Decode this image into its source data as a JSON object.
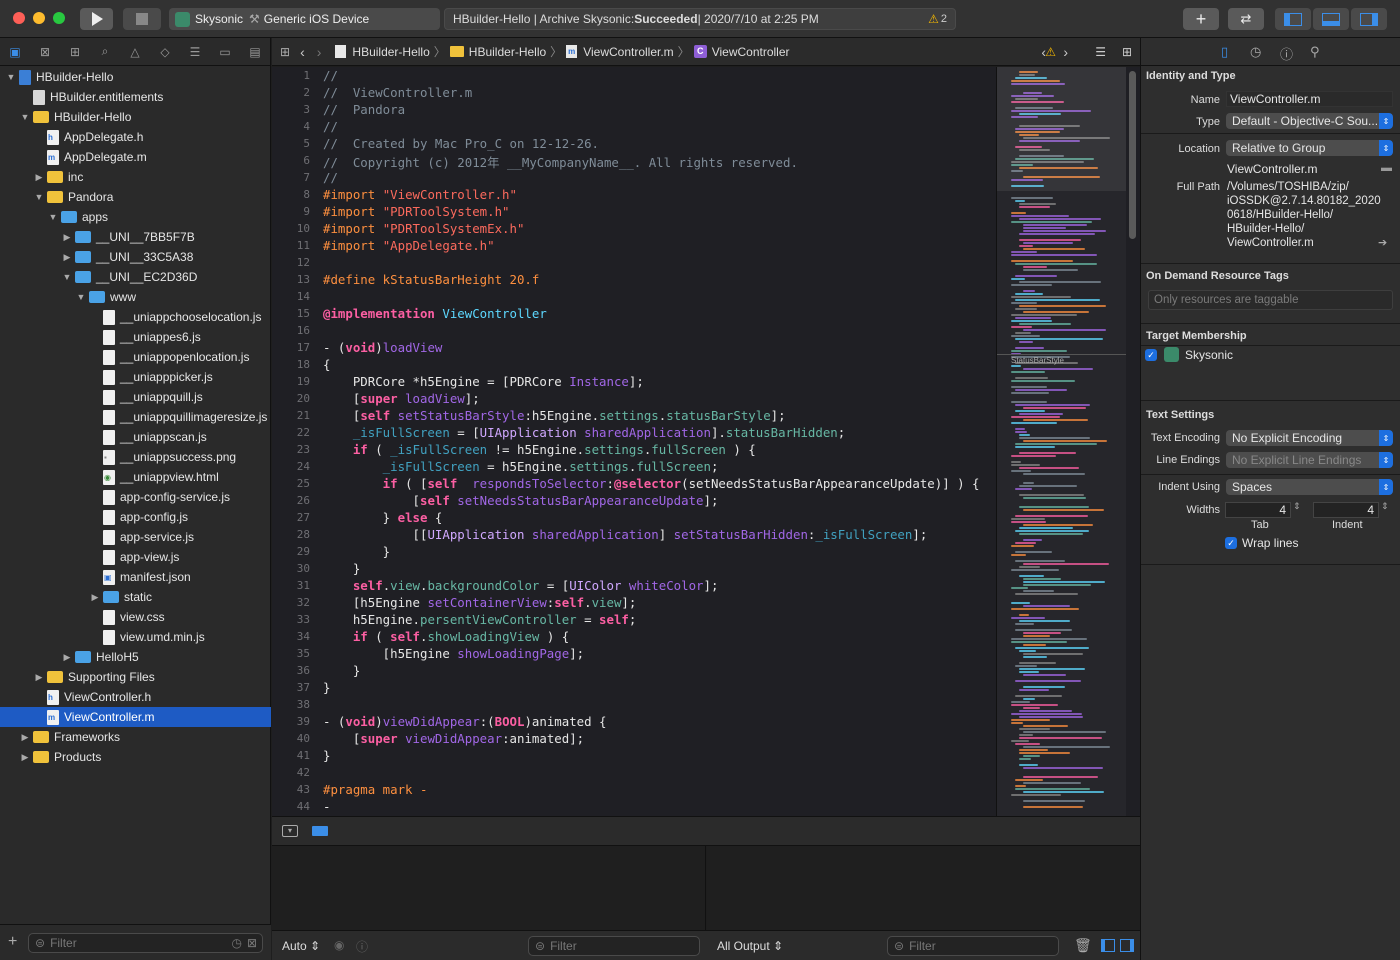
{
  "toolbar": {
    "scheme": "Skysonic",
    "device": "Generic iOS Device",
    "status_prefix": "HBuilder-Hello | Archive Skysonic: ",
    "status_result": "Succeeded",
    "status_time": " | 2020/7/10 at 2:25 PM",
    "warning_count": "2",
    "add_label": "+",
    "swap_label": "⇄"
  },
  "navigator": {
    "filter_placeholder": "Filter",
    "add_label": "+",
    "rows": [
      {
        "label": "HBuilder-Hello",
        "disc": "▼",
        "icon": "project",
        "indent": 0
      },
      {
        "label": "HBuilder.entitlements",
        "disc": "",
        "icon": "entitlements",
        "indent": 1
      },
      {
        "label": "HBuilder-Hello",
        "disc": "▼",
        "icon": "folder",
        "indent": 1
      },
      {
        "label": "AppDelegate.h",
        "disc": "",
        "icon": "h",
        "indent": 2
      },
      {
        "label": "AppDelegate.m",
        "disc": "",
        "icon": "m",
        "indent": 2
      },
      {
        "label": "inc",
        "disc": "▶",
        "icon": "folder",
        "indent": 2
      },
      {
        "label": "Pandora",
        "disc": "▼",
        "icon": "folder",
        "indent": 2
      },
      {
        "label": "apps",
        "disc": "▼",
        "icon": "bfolder",
        "indent": 3
      },
      {
        "label": "__UNI__7BB5F7B",
        "disc": "▶",
        "icon": "bfolder",
        "indent": 4
      },
      {
        "label": "__UNI__33C5A38",
        "disc": "▶",
        "icon": "bfolder",
        "indent": 4
      },
      {
        "label": "__UNI__EC2D36D",
        "disc": "▼",
        "icon": "bfolder",
        "indent": 4
      },
      {
        "label": "www",
        "disc": "▼",
        "icon": "bfolder",
        "indent": 5
      },
      {
        "label": "__uniappchooselocation.js",
        "disc": "",
        "icon": "doc",
        "indent": 6
      },
      {
        "label": "__uniappes6.js",
        "disc": "",
        "icon": "doc",
        "indent": 6
      },
      {
        "label": "__uniappopenlocation.js",
        "disc": "",
        "icon": "doc",
        "indent": 6
      },
      {
        "label": "__uniapppicker.js",
        "disc": "",
        "icon": "doc",
        "indent": 6
      },
      {
        "label": "__uniappquill.js",
        "disc": "",
        "icon": "doc",
        "indent": 6
      },
      {
        "label": "__uniappquillimageresize.js",
        "disc": "",
        "icon": "doc",
        "indent": 6
      },
      {
        "label": "__uniappscan.js",
        "disc": "",
        "icon": "doc",
        "indent": 6
      },
      {
        "label": "__uniappsuccess.png",
        "disc": "",
        "icon": "img",
        "indent": 6
      },
      {
        "label": "__uniappview.html",
        "disc": "",
        "icon": "html",
        "indent": 6
      },
      {
        "label": "app-config-service.js",
        "disc": "",
        "icon": "doc",
        "indent": 6
      },
      {
        "label": "app-config.js",
        "disc": "",
        "icon": "doc",
        "indent": 6
      },
      {
        "label": "app-service.js",
        "disc": "",
        "icon": "doc",
        "indent": 6
      },
      {
        "label": "app-view.js",
        "disc": "",
        "icon": "doc",
        "indent": 6
      },
      {
        "label": "manifest.json",
        "disc": "",
        "icon": "json",
        "indent": 6
      },
      {
        "label": "static",
        "disc": "▶",
        "icon": "bfolder",
        "indent": 6
      },
      {
        "label": "view.css",
        "disc": "",
        "icon": "doc",
        "indent": 6
      },
      {
        "label": "view.umd.min.js",
        "disc": "",
        "icon": "doc",
        "indent": 6
      },
      {
        "label": "HelloH5",
        "disc": "▶",
        "icon": "bfolder",
        "indent": 4
      },
      {
        "label": "Supporting Files",
        "disc": "▶",
        "icon": "folder",
        "indent": 2
      },
      {
        "label": "ViewController.h",
        "disc": "",
        "icon": "h",
        "indent": 2
      },
      {
        "label": "ViewController.m",
        "disc": "",
        "icon": "m",
        "indent": 2,
        "selected": true
      },
      {
        "label": "Frameworks",
        "disc": "▶",
        "icon": "folder",
        "indent": 1
      },
      {
        "label": "Products",
        "disc": "▶",
        "icon": "folder",
        "indent": 1
      }
    ]
  },
  "jumpbar": {
    "crumbs": [
      "HBuilder-Hello",
      "HBuilder-Hello",
      "ViewController.m",
      "ViewController"
    ]
  },
  "code_lines": [
    [
      [
        "c-cm",
        "//"
      ]
    ],
    [
      [
        "c-cm",
        "//  ViewController.m"
      ]
    ],
    [
      [
        "c-cm",
        "//  Pandora"
      ]
    ],
    [
      [
        "c-cm",
        "//"
      ]
    ],
    [
      [
        "c-cm",
        "//  Created by Mac Pro_C on 12-12-26."
      ]
    ],
    [
      [
        "c-cm",
        "//  Copyright (c) 2012年 __MyCompanyName__. All rights reserved."
      ]
    ],
    [
      [
        "c-cm",
        "//"
      ]
    ],
    [
      [
        "c-pp",
        "#import "
      ],
      [
        "c-st",
        "\"ViewController.h\""
      ]
    ],
    [
      [
        "c-pp",
        "#import "
      ],
      [
        "c-st",
        "\"PDRToolSystem.h\""
      ]
    ],
    [
      [
        "c-pp",
        "#import "
      ],
      [
        "c-st",
        "\"PDRToolSystemEx.h\""
      ]
    ],
    [
      [
        "c-pp",
        "#import "
      ],
      [
        "c-st",
        "\"AppDelegate.h\""
      ]
    ],
    [],
    [
      [
        "c-pp",
        "#define kStatusBarHeight 20.f"
      ]
    ],
    [],
    [
      [
        "c-kw",
        "@implementation "
      ],
      [
        "c-ty",
        "ViewController"
      ]
    ],
    [],
    [
      [
        "",
        "- ("
      ],
      [
        "c-kw",
        "void"
      ],
      [
        "",
        ")"
      ],
      [
        "c-mt",
        "loadView"
      ]
    ],
    [
      [
        "",
        "{"
      ]
    ],
    [
      [
        "",
        "    PDRCore *h5Engine = [PDRCore "
      ],
      [
        "c-mt",
        "Instance"
      ],
      [
        "",
        "];"
      ]
    ],
    [
      [
        "",
        "    ["
      ],
      [
        "c-kw",
        "super "
      ],
      [
        "c-mt",
        "loadView"
      ],
      [
        "",
        "];"
      ]
    ],
    [
      [
        "",
        "    ["
      ],
      [
        "c-kw",
        "self "
      ],
      [
        "c-mt",
        "setStatusBarStyle"
      ],
      [
        "",
        ":h5Engine."
      ],
      [
        "c-pr",
        "settings"
      ],
      [
        "",
        "."
      ],
      [
        "c-pr",
        "statusBarStyle"
      ],
      [
        "",
        "];"
      ]
    ],
    [
      [
        "c-id",
        "    _isFullScreen"
      ],
      [
        "",
        " = ["
      ],
      [
        "c-cls",
        "UIApplication "
      ],
      [
        "c-mt",
        "sharedApplication"
      ],
      [
        "",
        "]."
      ],
      [
        "c-pr",
        "statusBarHidden"
      ],
      [
        "",
        ";"
      ]
    ],
    [
      [
        "c-kw",
        "    if"
      ],
      [
        "",
        " ( "
      ],
      [
        "c-id",
        "_isFullScreen"
      ],
      [
        "",
        " != h5Engine."
      ],
      [
        "c-pr",
        "settings"
      ],
      [
        "",
        "."
      ],
      [
        "c-pr",
        "fullScreen"
      ],
      [
        "",
        " ) {"
      ]
    ],
    [
      [
        "c-id",
        "        _isFullScreen"
      ],
      [
        "",
        " = h5Engine."
      ],
      [
        "c-pr",
        "settings"
      ],
      [
        "",
        "."
      ],
      [
        "c-pr",
        "fullScreen"
      ],
      [
        "",
        ";"
      ]
    ],
    [
      [
        "c-kw",
        "        if"
      ],
      [
        "",
        " ( ["
      ],
      [
        "c-kw",
        "self"
      ],
      [
        "",
        "  "
      ],
      [
        "c-mt",
        "respondsToSelector"
      ],
      [
        "",
        ":"
      ],
      [
        "c-kw",
        "@selector"
      ],
      [
        "",
        "(setNeedsStatusBarAppearanceUpdate)] ) {"
      ]
    ],
    [
      [
        "",
        "            ["
      ],
      [
        "c-kw",
        "self "
      ],
      [
        "c-mt",
        "setNeedsStatusBarAppearanceUpdate"
      ],
      [
        "",
        "];"
      ]
    ],
    [
      [
        "",
        "        } "
      ],
      [
        "c-kw",
        "else"
      ],
      [
        "",
        " {"
      ]
    ],
    [
      [
        "",
        "            [["
      ],
      [
        "c-cls",
        "UIApplication "
      ],
      [
        "c-mt",
        "sharedApplication"
      ],
      [
        "",
        "] "
      ],
      [
        "c-mt",
        "setStatusBarHidden"
      ],
      [
        "",
        ":"
      ],
      [
        "c-id",
        "_isFullScreen"
      ],
      [
        "",
        "];"
      ]
    ],
    [
      [
        "",
        "        }"
      ]
    ],
    [
      [
        "",
        "    }"
      ]
    ],
    [
      [
        "c-kw",
        "    self"
      ],
      [
        "",
        "."
      ],
      [
        "c-pr",
        "view"
      ],
      [
        "",
        "."
      ],
      [
        "c-pr",
        "backgroundColor"
      ],
      [
        "",
        " = ["
      ],
      [
        "c-cls",
        "UIColor "
      ],
      [
        "c-mt",
        "whiteColor"
      ],
      [
        "",
        "];"
      ]
    ],
    [
      [
        "",
        "    [h5Engine "
      ],
      [
        "c-mt",
        "setContainerView"
      ],
      [
        "",
        ":"
      ],
      [
        "c-kw",
        "self"
      ],
      [
        "",
        "."
      ],
      [
        "c-pr",
        "view"
      ],
      [
        "",
        "];"
      ]
    ],
    [
      [
        "",
        "    h5Engine."
      ],
      [
        "c-pr",
        "persentViewController"
      ],
      [
        "",
        " = "
      ],
      [
        "c-kw",
        "self"
      ],
      [
        "",
        ";"
      ]
    ],
    [
      [
        "c-kw",
        "    if"
      ],
      [
        "",
        " ( "
      ],
      [
        "c-kw",
        "self"
      ],
      [
        "",
        "."
      ],
      [
        "c-pr",
        "showLoadingView"
      ],
      [
        "",
        " ) {"
      ]
    ],
    [
      [
        "",
        "        [h5Engine "
      ],
      [
        "c-mt",
        "showLoadingPage"
      ],
      [
        "",
        "];"
      ]
    ],
    [
      [
        "",
        "    }"
      ]
    ],
    [
      [
        "",
        "}"
      ]
    ],
    [],
    [
      [
        "",
        "- ("
      ],
      [
        "c-kw",
        "void"
      ],
      [
        "",
        ")"
      ],
      [
        "c-mt",
        "viewDidAppear"
      ],
      [
        "",
        ":("
      ],
      [
        "c-kw",
        "BOOL"
      ],
      [
        "",
        ")animated {"
      ]
    ],
    [
      [
        "",
        "    ["
      ],
      [
        "c-kw",
        "super "
      ],
      [
        "c-mt",
        "viewDidAppear"
      ],
      [
        "",
        ":animated];"
      ]
    ],
    [
      [
        "",
        "}"
      ]
    ],
    [],
    [
      [
        "c-pp",
        "#pragma mark -"
      ]
    ],
    [
      [
        "",
        "-"
      ]
    ]
  ],
  "minimap": {
    "marker_label": "StatusBarStyle"
  },
  "debug": {
    "auto_label": "Auto",
    "output_label": "All Output",
    "filter_placeholder": "Filter"
  },
  "inspector": {
    "identity_title": "Identity and Type",
    "name_label": "Name",
    "name_value": "ViewController.m",
    "type_label": "Type",
    "type_value": "Default - Objective-C Sou...",
    "location_label": "Location",
    "location_value": "Relative to Group",
    "location_file": "ViewController.m",
    "fullpath_label": "Full Path",
    "fullpath_lines": [
      "/Volumes/TOSHIBA/zip/",
      "iOSSDK@2.7.14.80182_2020",
      "0618/HBuilder-Hello/",
      "HBuilder-Hello/",
      "ViewController.m"
    ],
    "odr_title": "On Demand Resource Tags",
    "odr_placeholder": "Only resources are taggable",
    "target_title": "Target Membership",
    "target_name": "Skysonic",
    "text_title": "Text Settings",
    "encoding_label": "Text Encoding",
    "encoding_value": "No Explicit Encoding",
    "endings_label": "Line Endings",
    "endings_value": "No Explicit Line Endings",
    "indent_label": "Indent Using",
    "indent_value": "Spaces",
    "widths_label": "Widths",
    "tab_value": "4",
    "indent_width_value": "4",
    "tab_caption": "Tab",
    "indent_caption": "Indent",
    "wrap_label": "Wrap lines"
  }
}
